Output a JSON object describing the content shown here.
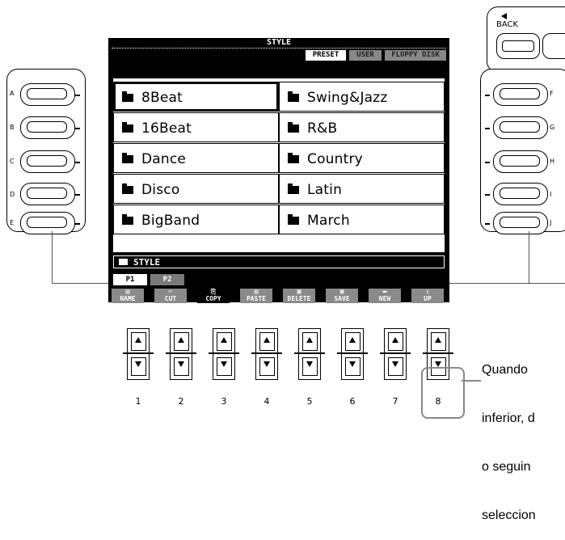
{
  "top": {
    "back_label": "BACK"
  },
  "lcd": {
    "title": "STYLE",
    "tabs": [
      "PRESET",
      "USER",
      "FLOPPY DISK"
    ],
    "left_items": [
      "8Beat",
      "16Beat",
      "Dance",
      "Disco",
      "BigBand"
    ],
    "right_items": [
      "Swing&Jazz",
      "R&B",
      "Country",
      "Latin",
      "March"
    ],
    "path": "STYLE",
    "pages": [
      "P1",
      "P2"
    ],
    "functions": [
      {
        "icon": "▤",
        "label": "NAME"
      },
      {
        "icon": "✂",
        "label": "CUT"
      },
      {
        "icon": "⎘",
        "label": "COPY"
      },
      {
        "icon": "▥",
        "label": "PASTE"
      },
      {
        "icon": "▦",
        "label": "DELETE"
      },
      {
        "icon": "▣",
        "label": "SAVE"
      },
      {
        "icon": "▬",
        "label": "NEW"
      },
      {
        "icon": "⇧",
        "label": "UP"
      }
    ]
  },
  "side_left_letters": [
    "A",
    "B",
    "C",
    "D",
    "E"
  ],
  "side_right_letters": [
    "F",
    "G",
    "H",
    "I",
    "J"
  ],
  "bottom_numbers": [
    "1",
    "2",
    "3",
    "4",
    "5",
    "6",
    "7",
    "8"
  ],
  "note_lines": [
    "Quando",
    "inferior, d",
    "o seguin",
    "seleccion"
  ]
}
